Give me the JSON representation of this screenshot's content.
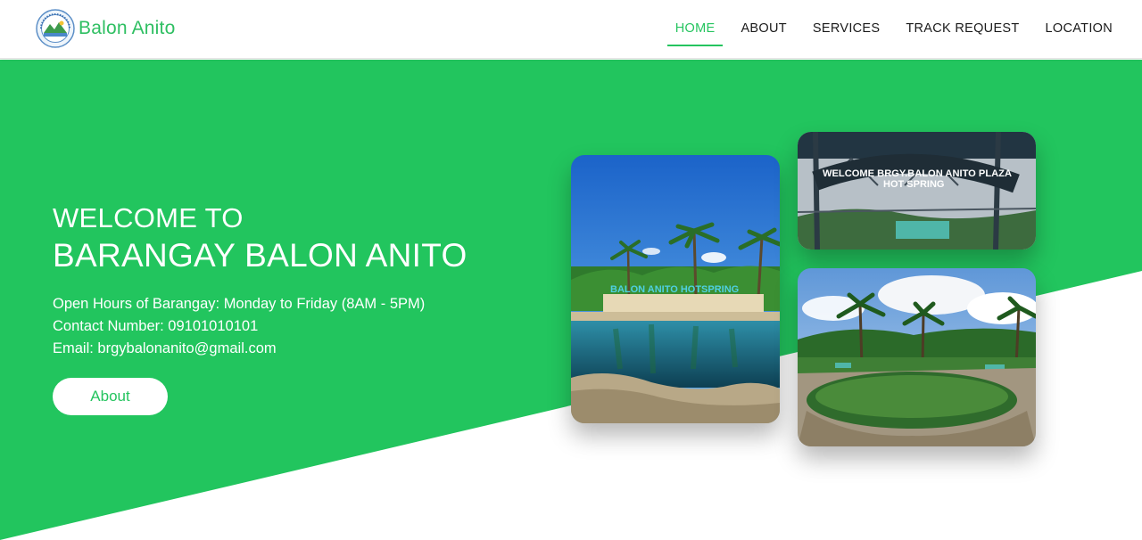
{
  "brand": {
    "name": "Balon Anito",
    "logo_icon": "barangay-seal-icon"
  },
  "nav": {
    "items": [
      {
        "label": "HOME",
        "active": true
      },
      {
        "label": "ABOUT",
        "active": false
      },
      {
        "label": "SERVICES",
        "active": false
      },
      {
        "label": "TRACK REQUEST",
        "active": false
      },
      {
        "label": "LOCATION",
        "active": false
      }
    ]
  },
  "hero": {
    "title_line1": "WELCOME TO",
    "title_line2": "BARANGAY BALON ANITO",
    "hours": "Open Hours of Barangay: Monday to Friday (8AM - 5PM)",
    "contact": "Contact Number: 09101010101",
    "email": "Email: brgybalonanito@gmail.com",
    "button_label": "About"
  },
  "photos": {
    "hotspring_sign": "BALON ANITO HOTSPRING",
    "plaza_sign_line1": "WELCOME BRGY.BALON ANITO PLAZA",
    "plaza_sign_line2": "HOT SPRING"
  },
  "colors": {
    "accent": "#25c45f",
    "brand_text": "#2fbf62",
    "hero_bg": "#22c55e"
  }
}
